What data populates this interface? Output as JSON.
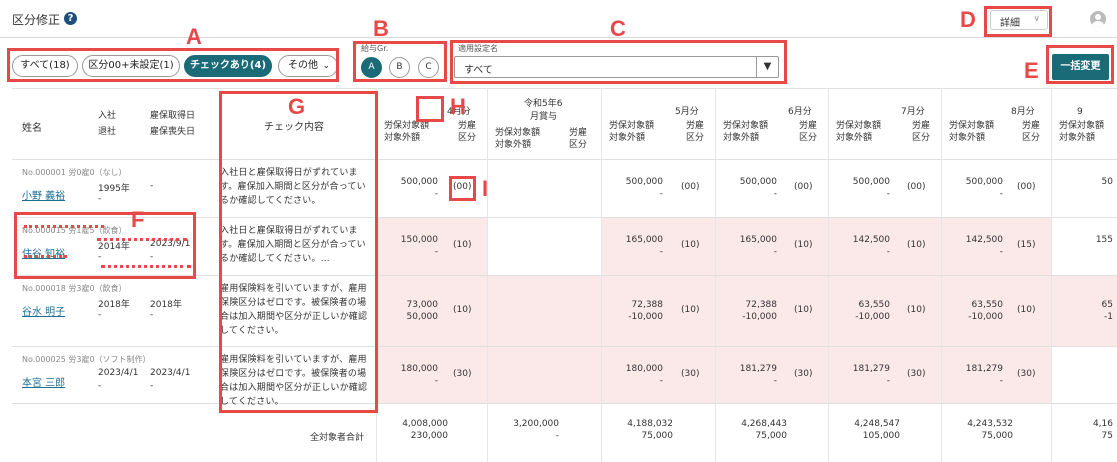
{
  "header": {
    "title": "区分修正",
    "help_icon": "question-icon",
    "detail_label": "詳細",
    "user_icon": "user-avatar-icon"
  },
  "filters": {
    "tabs": [
      {
        "label": "すべて(18)"
      },
      {
        "label": "区分00+未設定(1)"
      },
      {
        "label": "チェックあり(4)",
        "active": true
      },
      {
        "label": "その他"
      }
    ],
    "kyuyo_group_label": "給与Gr.",
    "kyuyo_groups": [
      "A",
      "B",
      "C"
    ],
    "apply_setting_label": "適用設定名",
    "apply_setting_value": "すべて",
    "bulk_change_label": "一括変更"
  },
  "annotations": [
    "A",
    "B",
    "C",
    "D",
    "E",
    "F",
    "G",
    "H",
    "I"
  ],
  "table": {
    "headers": {
      "name": "姓名",
      "join": "入社",
      "leave": "退社",
      "ins_get": "雇保取得日",
      "ins_lose": "雇保喪失日",
      "check": "チェック内容",
      "amount_a": "労保対象額",
      "amount_b": "対象外額",
      "kbn_a": "労雇",
      "kbn_b": "区分"
    },
    "months": [
      {
        "label": "4月分"
      },
      {
        "label": "令和5年6",
        "sub": "月賞与",
        "amount_a": "労保対象額",
        "amount_b": "対象外額"
      },
      {
        "label": "5月分"
      },
      {
        "label": "6月分"
      },
      {
        "label": "7月分"
      },
      {
        "label": "8月分"
      },
      {
        "label": "9"
      }
    ],
    "rows": [
      {
        "meta": "No.000001 労0雇0（なし）",
        "name": "小野 義裕",
        "join": "1995年",
        "leave": "-",
        "ins_get": "-",
        "ins_lose": "",
        "check": "入社日と雇保取得日がずれています。雇保加入期間と区分が合っているか確認してください。",
        "cells": [
          {
            "a": "500,000",
            "b": "-",
            "k": "(00)"
          },
          {
            "a": "",
            "b": "",
            "k": ""
          },
          {
            "a": "500,000",
            "b": "-",
            "k": "(00)"
          },
          {
            "a": "500,000",
            "b": "-",
            "k": "(00)"
          },
          {
            "a": "500,000",
            "b": "-",
            "k": "(00)"
          },
          {
            "a": "500,000",
            "b": "-",
            "k": "(00)"
          },
          {
            "a": "50",
            "b": "",
            "k": ""
          }
        ]
      },
      {
        "meta": "No.000015 労1雇5（飲食）",
        "name": "住谷 知裕",
        "join": "2014年",
        "leave": "-",
        "ins_get": "2023/9/1",
        "ins_lose": "-",
        "check": "入社日と雇保取得日がずれています。雇保加入期間と区分が合っているか確認してください。…",
        "cells": [
          {
            "a": "150,000",
            "b": "-",
            "k": "(10)"
          },
          {
            "a": "",
            "b": "",
            "k": ""
          },
          {
            "a": "165,000",
            "b": "-",
            "k": "(10)"
          },
          {
            "a": "165,000",
            "b": "-",
            "k": "(10)"
          },
          {
            "a": "142,500",
            "b": "-",
            "k": "(10)"
          },
          {
            "a": "142,500",
            "b": "-",
            "k": "(15)"
          },
          {
            "a": "155",
            "b": "",
            "k": ""
          }
        ]
      },
      {
        "meta": "No.000018 労3雇0（飲食）",
        "name": "谷水 明子",
        "join": "2018年",
        "leave": "-",
        "ins_get": "2018年",
        "ins_lose": "-",
        "check": "雇用保険料を引いていますが、雇用保険区分はゼロです。被保険者の場合は加入期間や区分が正しいか確認してください。",
        "cells": [
          {
            "a": "73,000",
            "b": "50,000",
            "k": "(10)"
          },
          {
            "a": "",
            "b": "",
            "k": ""
          },
          {
            "a": "72,388",
            "b": "-10,000",
            "k": "(10)"
          },
          {
            "a": "72,388",
            "b": "-10,000",
            "k": "(10)"
          },
          {
            "a": "63,550",
            "b": "-10,000",
            "k": "(10)"
          },
          {
            "a": "63,550",
            "b": "-10,000",
            "k": "(10)"
          },
          {
            "a": "65",
            "b": "-1",
            "k": ""
          }
        ]
      },
      {
        "meta": "No.000025 労3雇0（ソフト制作）",
        "name": "本宮 三郎",
        "join": "2023/4/1",
        "leave": "-",
        "ins_get": "2023/4/1",
        "ins_lose": "-",
        "check": "雇用保険料を引いていますが、雇用保険区分はゼロです。被保険者の場合は加入期間や区分が正しいか確認してください。",
        "cells": [
          {
            "a": "180,000",
            "b": "-",
            "k": "(30)"
          },
          {
            "a": "",
            "b": "",
            "k": ""
          },
          {
            "a": "180,000",
            "b": "-",
            "k": "(30)"
          },
          {
            "a": "181,279",
            "b": "-",
            "k": "(30)"
          },
          {
            "a": "181,279",
            "b": "-",
            "k": "(30)"
          },
          {
            "a": "181,279",
            "b": "-",
            "k": "(30)"
          },
          {
            "a": "",
            "b": "",
            "k": ""
          }
        ]
      }
    ],
    "total": {
      "label": "全対象者合計",
      "cells": [
        {
          "a": "4,008,000",
          "b": "230,000"
        },
        {
          "a": "3,200,000",
          "b": "-"
        },
        {
          "a": "4,188,032",
          "b": "75,000"
        },
        {
          "a": "4,268,443",
          "b": "75,000"
        },
        {
          "a": "4,248,547",
          "b": "105,000"
        },
        {
          "a": "4,243,532",
          "b": "75,000"
        },
        {
          "a": "4,16",
          "b": "75"
        }
      ]
    }
  }
}
